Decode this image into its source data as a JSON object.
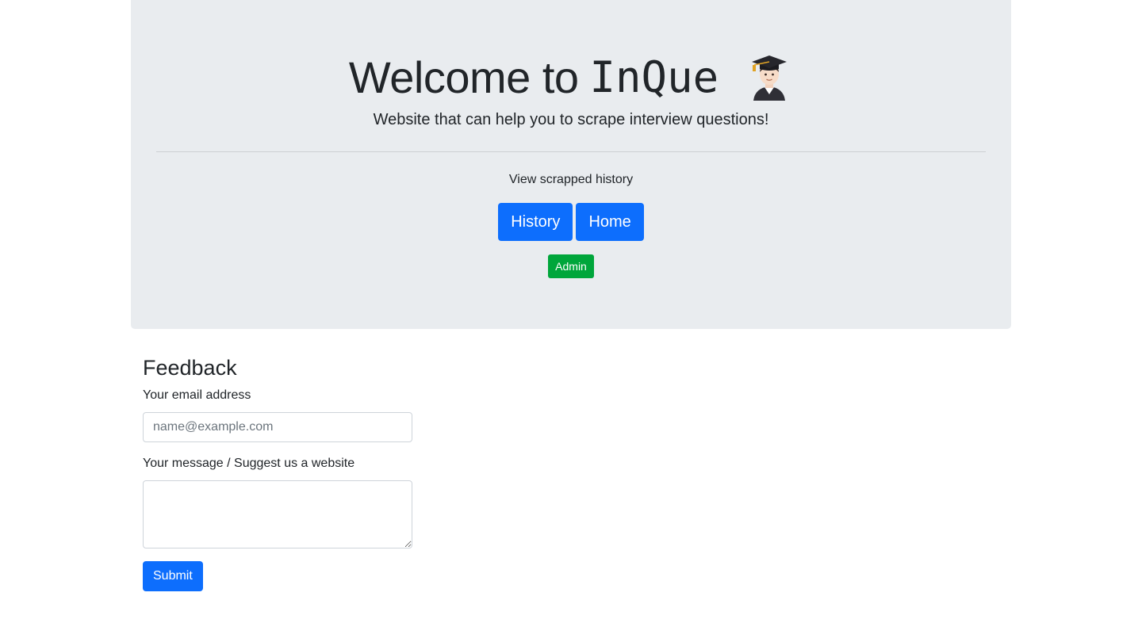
{
  "hero": {
    "title_prefix": "Welcome to",
    "brand": "InQue",
    "icon": "student-graduate-emoji-icon",
    "subtitle": "Website that can help you to scrape interview questions!",
    "history_caption": "View scrapped history",
    "history_button": "History",
    "home_button": "Home",
    "admin_button": "Admin"
  },
  "feedback": {
    "heading": "Feedback",
    "email_label": "Your email address",
    "email_placeholder": "name@example.com",
    "email_value": "",
    "message_label": "Your message / Suggest us a website",
    "message_value": "",
    "submit_label": "Submit"
  },
  "colors": {
    "hero_background": "#e9ecef",
    "primary": "#0d6efd",
    "success": "#00a63b",
    "text": "#212529"
  }
}
